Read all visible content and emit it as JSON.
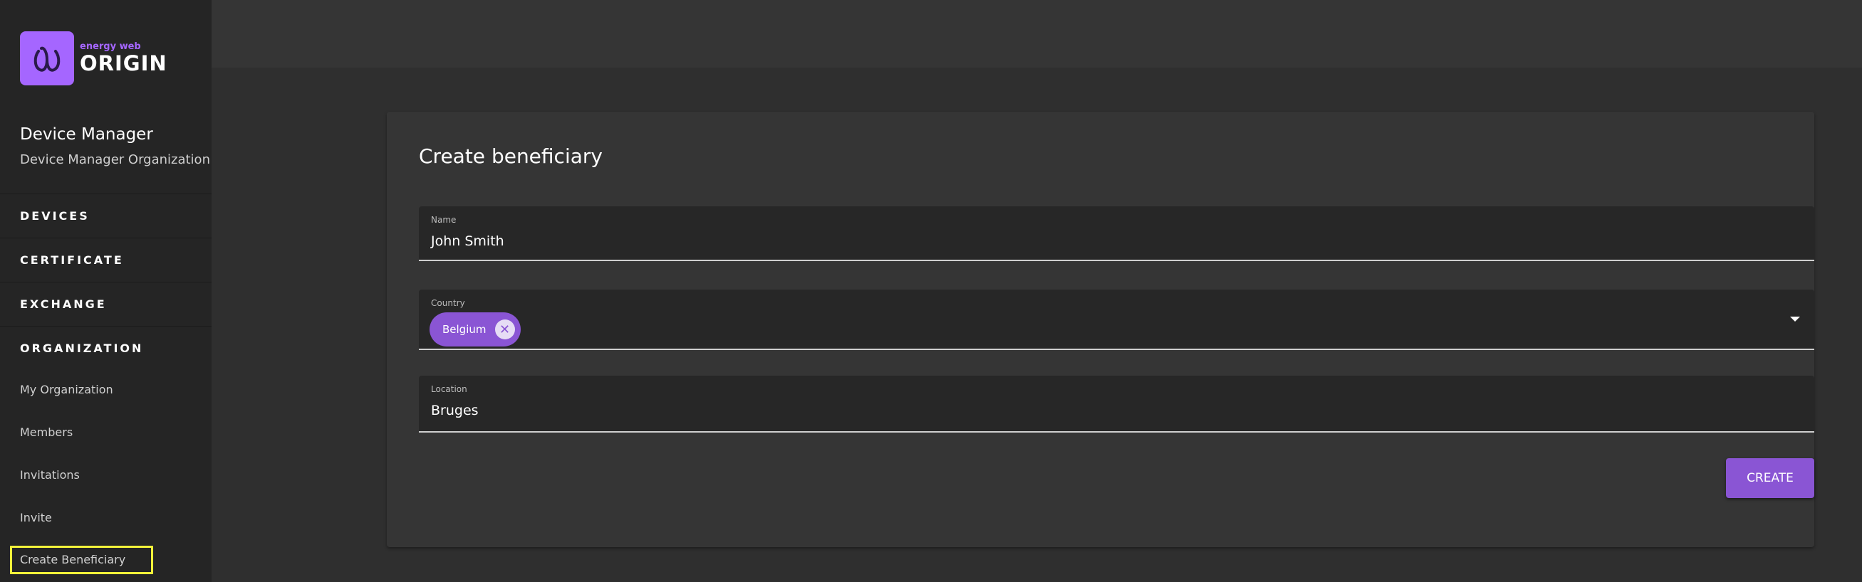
{
  "brand": {
    "small_text": "energy web",
    "big_text": "ORIGIN",
    "accent_color": "#a566ff",
    "logo_icon": "energy-web-logo-icon"
  },
  "user": {
    "name": "Device Manager",
    "organization": "Device Manager Organization"
  },
  "sidebar": {
    "sections": [
      {
        "label": "DEVICES"
      },
      {
        "label": "CERTIFICATE"
      },
      {
        "label": "EXCHANGE"
      },
      {
        "label": "ORGANIZATION"
      }
    ],
    "organization_items": [
      {
        "label": "My Organization"
      },
      {
        "label": "Members"
      },
      {
        "label": "Invitations"
      },
      {
        "label": "Invite"
      },
      {
        "label": "Create Beneficiary"
      }
    ],
    "highlight_color": "#f2f23a"
  },
  "form": {
    "title": "Create beneficiary",
    "name": {
      "label": "Name",
      "value": "John  Smith"
    },
    "country": {
      "label": "Country",
      "selected_chip": "Belgium",
      "chip_remove_icon": "close-circle-icon"
    },
    "location": {
      "label": "Location",
      "value": "Bruges"
    },
    "submit_label": "CREATE",
    "button_color": "#8a55d4"
  }
}
